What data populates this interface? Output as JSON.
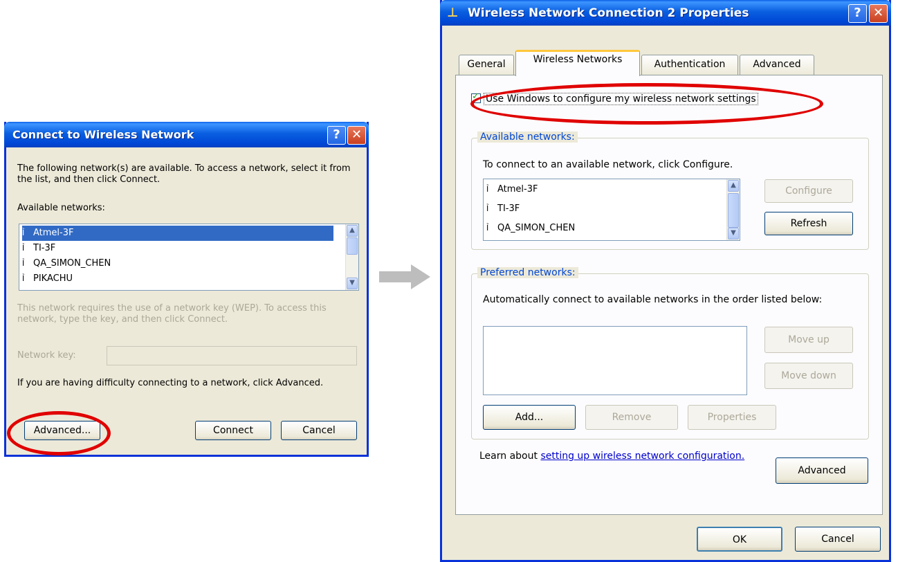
{
  "dialog1": {
    "title": "Connect to Wireless Network",
    "help_label": "?",
    "close_label": "✕",
    "intro": "The following network(s) are available. To access a network, select it from the list, and then click Connect.",
    "available_label": "Available networks:",
    "networks": [
      "Atmel-3F",
      "TI-3F",
      "QA_SIMON_CHEN",
      "PIKACHU"
    ],
    "selected_network": "Atmel-3F",
    "wep_note": "This network requires the use of a network key (WEP). To access this network, type the key, and then click Connect.",
    "network_key_label": "Network key:",
    "network_key_value": "",
    "difficulty_text": "If you are having difficulty connecting to a network, click Advanced.",
    "advanced_button": "Advanced...",
    "connect_button": "Connect",
    "cancel_button": "Cancel"
  },
  "arrow_icon": "right-arrow-icon",
  "dialog2": {
    "title": "Wireless Network Connection 2 Properties",
    "help_label": "?",
    "close_label": "✕",
    "tabs": [
      "General",
      "Wireless Networks",
      "Authentication",
      "Advanced"
    ],
    "active_tab": "Wireless Networks",
    "use_windows_checkbox": "Use Windows to configure my wireless network settings",
    "use_windows_checked": true,
    "available_group_label": "Available networks:",
    "available_help": "To connect to an available network, click Configure.",
    "networks": [
      "Atmel-3F",
      "TI-3F",
      "QA_SIMON_CHEN"
    ],
    "configure_button": "Configure",
    "refresh_button": "Refresh",
    "preferred_group_label": "Preferred networks:",
    "preferred_help": "Automatically connect to available networks in the order listed below:",
    "move_up_button": "Move up",
    "move_down_button": "Move down",
    "add_button": "Add...",
    "remove_button": "Remove",
    "properties_button": "Properties",
    "learn_prefix": "Learn about",
    "learn_link": "setting up wireless network configuration.",
    "advanced_button": "Advanced",
    "ok_button": "OK",
    "cancel_button": "Cancel"
  },
  "colors": {
    "highlight_ellipse": "#e00000",
    "title_bar": "#0a5fe0",
    "dialog_face": "#ece9d8",
    "selection": "#316ac5"
  }
}
